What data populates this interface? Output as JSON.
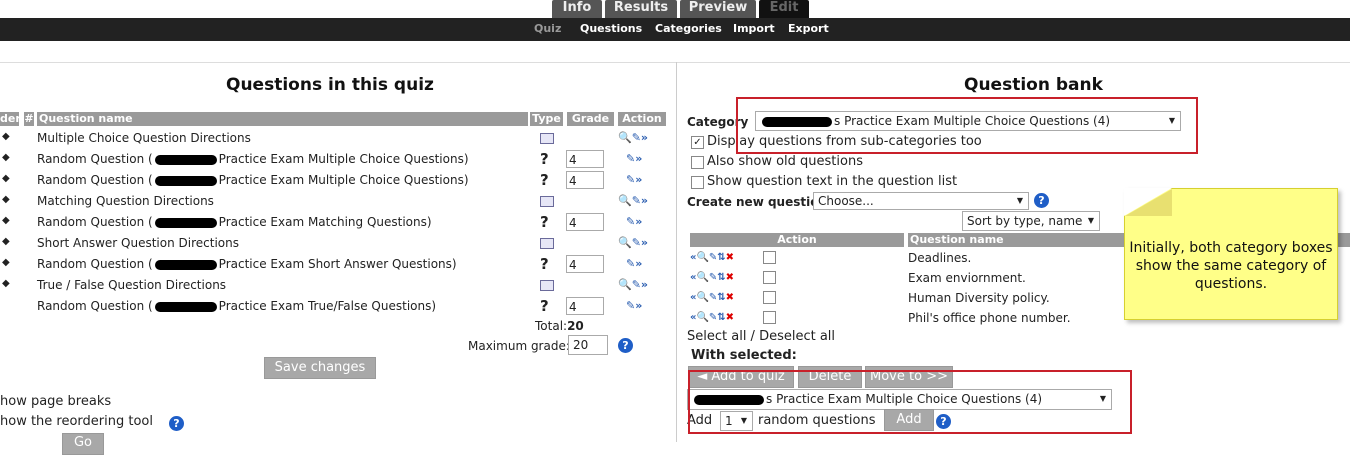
{
  "tabs": [
    {
      "label": "Info",
      "active": false
    },
    {
      "label": "Results",
      "active": false
    },
    {
      "label": "Preview",
      "active": false
    },
    {
      "label": "Edit",
      "active": true
    }
  ],
  "subnav": [
    "Quiz",
    "Questions",
    "Categories",
    "Import",
    "Export"
  ],
  "left": {
    "title": "Questions in this quiz",
    "headers": {
      "order": "der",
      "num": "#",
      "name": "Question name",
      "type": "Type",
      "grade": "Grade",
      "action": "Action"
    },
    "rows": [
      {
        "pre": "Multiple Choice Question Directions",
        "post": "",
        "type": "description",
        "grade": ""
      },
      {
        "pre": "Random Question (",
        "post": "Practice Exam Multiple Choice Questions)",
        "type": "random",
        "grade": "4"
      },
      {
        "pre": "Random Question (",
        "post": "Practice Exam Multiple Choice Questions)",
        "type": "random",
        "grade": "4"
      },
      {
        "pre": "Matching Question Directions",
        "post": "",
        "type": "description",
        "grade": ""
      },
      {
        "pre": "Random Question (",
        "post": "Practice Exam Matching Questions)",
        "type": "random",
        "grade": "4"
      },
      {
        "pre": "Short Answer Question Directions",
        "post": "",
        "type": "description",
        "grade": ""
      },
      {
        "pre": "Random Question (",
        "post": "Practice Exam Short Answer Questions)",
        "type": "random",
        "grade": "4"
      },
      {
        "pre": "True / False Question Directions",
        "post": "",
        "type": "description",
        "grade": ""
      },
      {
        "pre": "Random Question (",
        "post": "Practice Exam True/False Questions)",
        "type": "random",
        "grade": "4"
      }
    ],
    "total_label": "Total:",
    "total_value": "20",
    "max_grade_label": "Maximum grade:",
    "max_grade_value": "20",
    "save_button": "Save changes",
    "show_page_breaks": "how page breaks",
    "show_reorder": "how the reordering tool",
    "go_button": "Go"
  },
  "right": {
    "title": "Question bank",
    "category_label": "Category",
    "category_value": "s Practice Exam Multiple Choice Questions (4)",
    "opt_subcats": "Display questions from sub-categories too",
    "opt_subcats_checked": true,
    "opt_old": "Also show old questions",
    "opt_text": "Show question text in the question list",
    "create_label": "Create new question",
    "create_value": "Choose...",
    "sort_value": "Sort by type, name",
    "th_action": "Action",
    "th_name": "Question name",
    "questions": [
      "Deadlines.",
      "Exam enviornment.",
      "Human Diversity policy.",
      "Phil's office phone number."
    ],
    "select_all": "Select all / Deselect all",
    "with_selected": "With selected:",
    "btn_add_quiz": "◄ Add to quiz",
    "btn_delete": "Delete",
    "btn_move": "Move to >>",
    "move_category": "s Practice Exam Multiple Choice Questions (4)",
    "add_label": "Add",
    "add_count": "1",
    "random_label": "random questions",
    "add_button": "Add"
  },
  "note": "Initially, both category boxes show the same category of questions.",
  "colors": {
    "redbox": "#c8202a",
    "note_bg": "#ffff88",
    "help": "#1f5ec7"
  }
}
